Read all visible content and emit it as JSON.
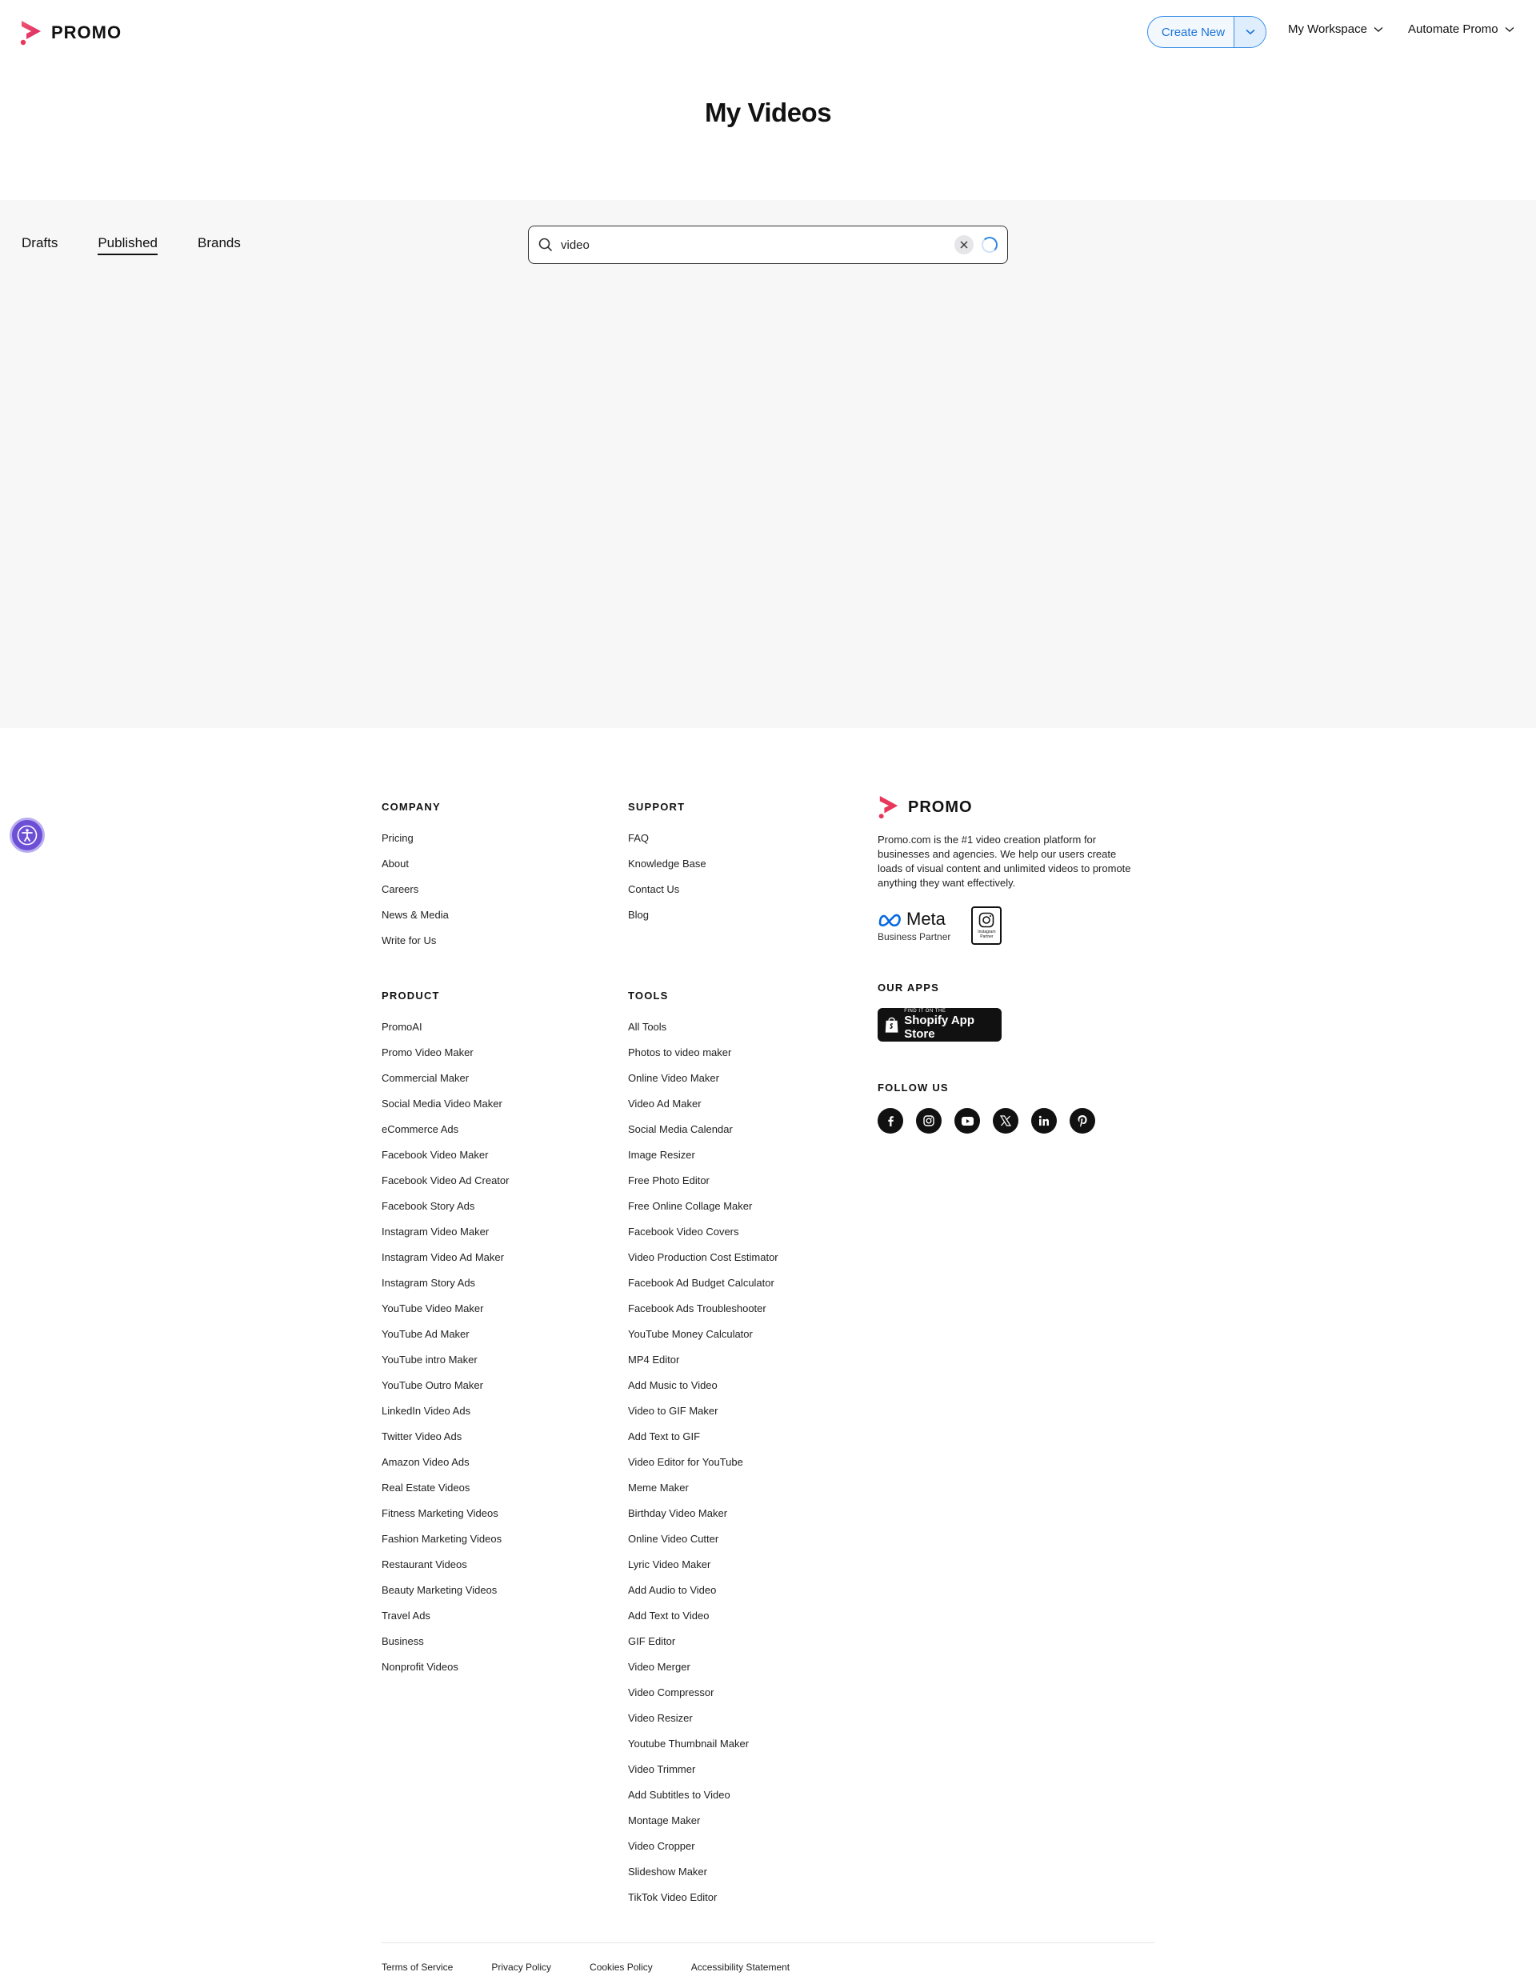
{
  "header": {
    "logo_text": "PROMO",
    "create_new": "Create New",
    "nav": [
      "My Workspace",
      "Automate Promo"
    ]
  },
  "page": {
    "title": "My Videos"
  },
  "tabs": [
    {
      "label": "Drafts",
      "active": false
    },
    {
      "label": "Published",
      "active": true
    },
    {
      "label": "Brands",
      "active": false
    }
  ],
  "search": {
    "value": "video"
  },
  "footer": {
    "company": {
      "title": "COMPANY",
      "items": [
        "Pricing",
        "About",
        "Careers",
        "News & Media",
        "Write for Us"
      ]
    },
    "support": {
      "title": "SUPPORT",
      "items": [
        "FAQ",
        "Knowledge Base",
        "Contact Us",
        "Blog"
      ]
    },
    "product": {
      "title": "PRODUCT",
      "items": [
        "PromoAI",
        "Promo Video Maker",
        "Commercial Maker",
        "Social Media Video Maker",
        "eCommerce Ads",
        "Facebook Video Maker",
        "Facebook Video Ad Creator",
        "Facebook Story Ads",
        "Instagram Video Maker",
        "Instagram Video Ad Maker",
        "Instagram Story Ads",
        "YouTube Video Maker",
        "YouTube Ad Maker",
        "YouTube intro Maker",
        "YouTube Outro Maker",
        "LinkedIn Video Ads",
        "Twitter Video Ads",
        "Amazon Video Ads",
        "Real Estate Videos",
        "Fitness Marketing Videos",
        "Fashion Marketing Videos",
        "Restaurant Videos",
        "Beauty Marketing Videos",
        "Travel Ads",
        "Business",
        "Nonprofit Videos"
      ]
    },
    "tools": {
      "title": "TOOLS",
      "items": [
        "All Tools",
        "Photos to video maker",
        "Online Video Maker",
        "Video Ad Maker",
        "Social Media Calendar",
        "Image Resizer",
        "Free Photo Editor",
        "Free Online Collage Maker",
        "Facebook Video Covers",
        "Video Production Cost Estimator",
        "Facebook Ad Budget Calculator",
        "Facebook Ads Troubleshooter",
        "YouTube Money Calculator",
        "MP4 Editor",
        "Add Music to Video",
        "Video to GIF Maker",
        "Add Text to GIF",
        "Video Editor for YouTube",
        "Meme Maker",
        "Birthday Video Maker",
        "Online Video Cutter",
        "Lyric Video Maker",
        "Add Audio to Video",
        "Add Text to Video",
        "GIF Editor",
        "Video Merger",
        "Video Compressor",
        "Video Resizer",
        "Youtube Thumbnail Maker",
        "Video Trimmer",
        "Add Subtitles to Video",
        "Montage Maker",
        "Video Cropper",
        "Slideshow Maker",
        "TikTok Video Editor"
      ]
    },
    "brand": {
      "logo_text": "PROMO",
      "description": "Promo.com is the #1 video creation platform for businesses and agencies. We help our users create loads of visual content and unlimited videos to promote anything they want effectively.",
      "meta_name": "Meta",
      "meta_sub": "Business Partner",
      "ig_partner_label": "Instagram Partner"
    },
    "apps": {
      "title": "OUR APPS",
      "badge_small": "FIND IT ON THE",
      "badge_big": "Shopify App Store"
    },
    "follow": {
      "title": "FOLLOW US",
      "icons": [
        "facebook-icon",
        "instagram-icon",
        "youtube-icon",
        "x-icon",
        "linkedin-icon",
        "pinterest-icon"
      ]
    },
    "legal": [
      "Terms of Service",
      "Privacy Policy",
      "Cookies Policy",
      "Accessibility Statement"
    ]
  },
  "colors": {
    "brand_red": "#e8375a",
    "brand_purple": "#b52a8f",
    "accent_blue": "#1a73d9",
    "content_bg": "#f7f7f8"
  }
}
